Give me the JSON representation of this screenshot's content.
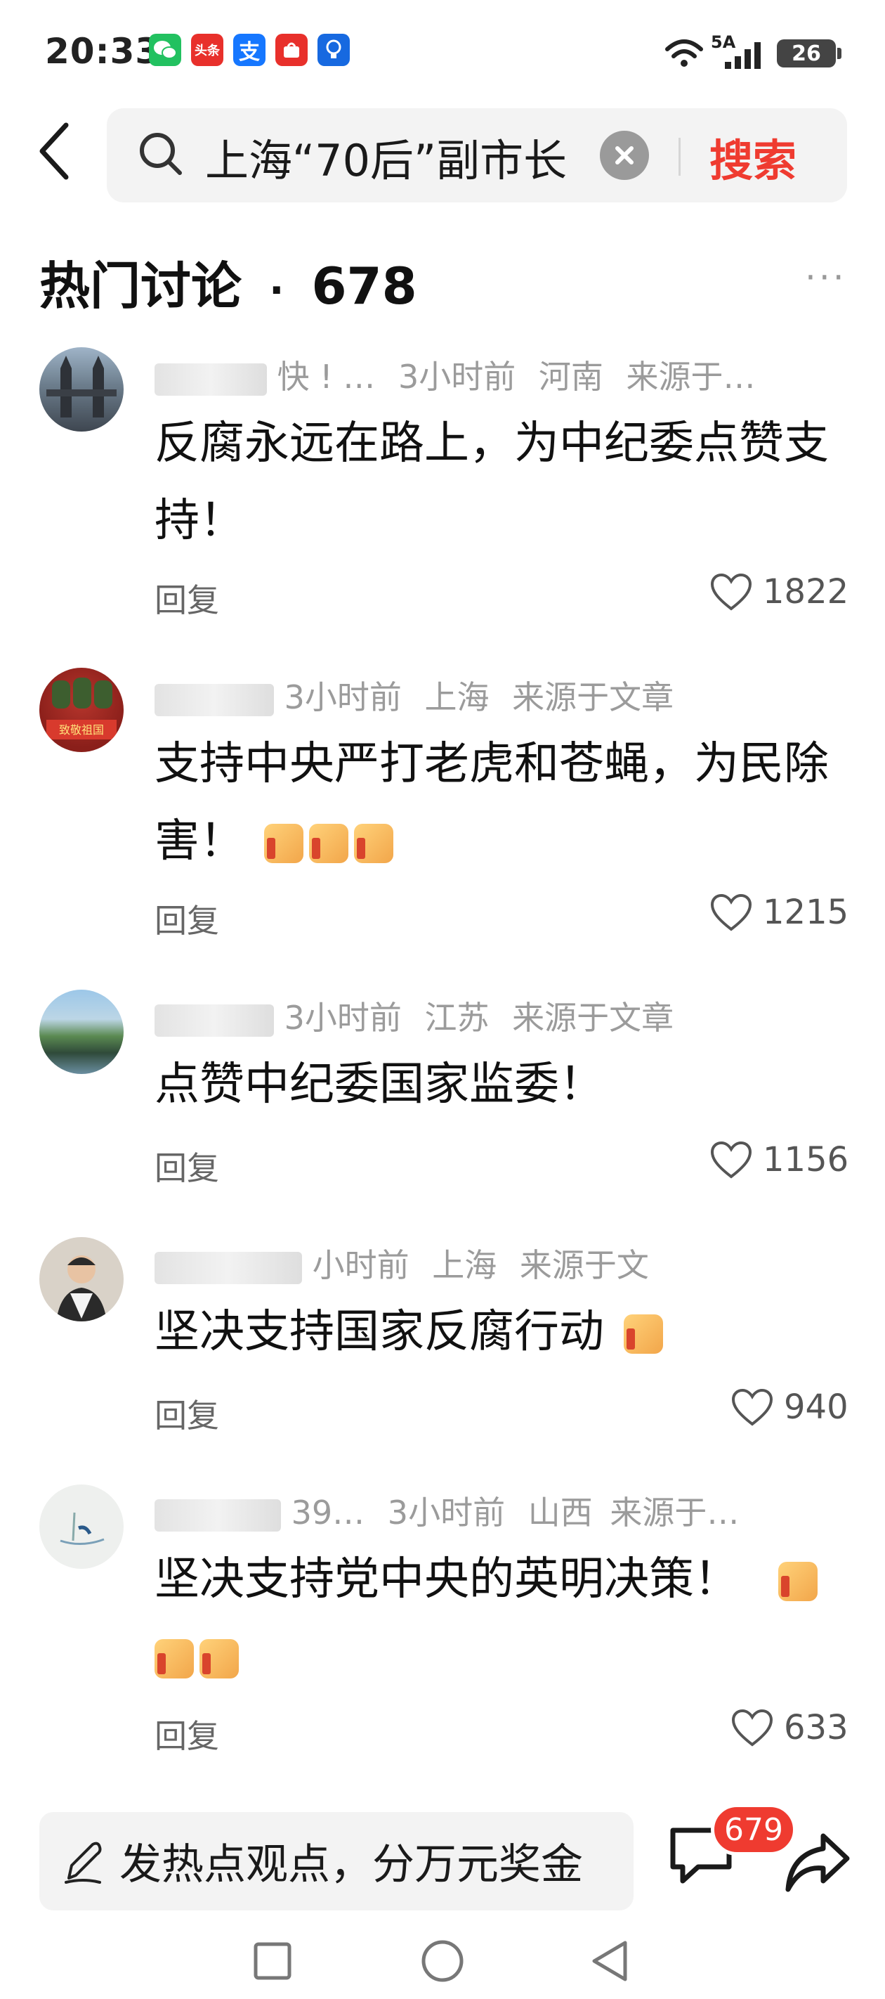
{
  "status_bar": {
    "time": "20:33",
    "app_icons": [
      {
        "name": "wechat-icon",
        "color": "#22c160",
        "text": ""
      },
      {
        "name": "toutiao-icon",
        "color": "#e8302b",
        "text": "头条"
      },
      {
        "name": "alipay-icon",
        "color": "#1677ff",
        "text": "支"
      },
      {
        "name": "appgallery-icon",
        "color": "#e8302b",
        "text": ""
      },
      {
        "name": "bulb-app-icon",
        "color": "#1769e0",
        "text": ""
      }
    ],
    "network": "5A",
    "battery": "26"
  },
  "search": {
    "query": "上海“70后”副市长",
    "button_label": "搜索"
  },
  "section": {
    "title": "热门讨论",
    "separator": "·",
    "count": "678"
  },
  "comments": [
    {
      "meta_visible": "快 ! … ",
      "time": "3小时前",
      "location": "河南",
      "source": "来源于…",
      "content": "反腐永远在路上，为中纪委点赞支持！",
      "emoji_count": 0,
      "reply_label": "回复",
      "likes": "1822"
    },
    {
      "meta_visible": "",
      "time": "3小时前",
      "location": "上海",
      "source": "来源于文章",
      "content": "支持中央严打老虎和苍蝇，为民除害！",
      "emoji_count": 3,
      "reply_label": "回复",
      "likes": "1215"
    },
    {
      "meta_visible": "",
      "time": "3小时前",
      "location": "江苏",
      "source": "来源于文章",
      "content": "点赞中纪委国家监委！",
      "emoji_count": 0,
      "reply_label": "回复",
      "likes": "1156"
    },
    {
      "meta_visible": "",
      "time": "小时前",
      "location": "上海",
      "source": "来源于文",
      "content": "坚决支持国家反腐行动",
      "emoji_count": 1,
      "reply_label": "回复",
      "likes": "940"
    },
    {
      "meta_visible": "39…",
      "time": "3小时前",
      "location": "山西",
      "source": "来源于…",
      "content": "坚决支持党中央的英明决策！",
      "emoji_count": 3,
      "reply_label": "回复",
      "likes": "633"
    }
  ],
  "bottom_bar": {
    "compose_placeholder": "发热点观点，分万元奖金",
    "comment_count": "679"
  },
  "colors": {
    "accent": "#ef3b30",
    "meta_gray": "#9b9b9b"
  }
}
